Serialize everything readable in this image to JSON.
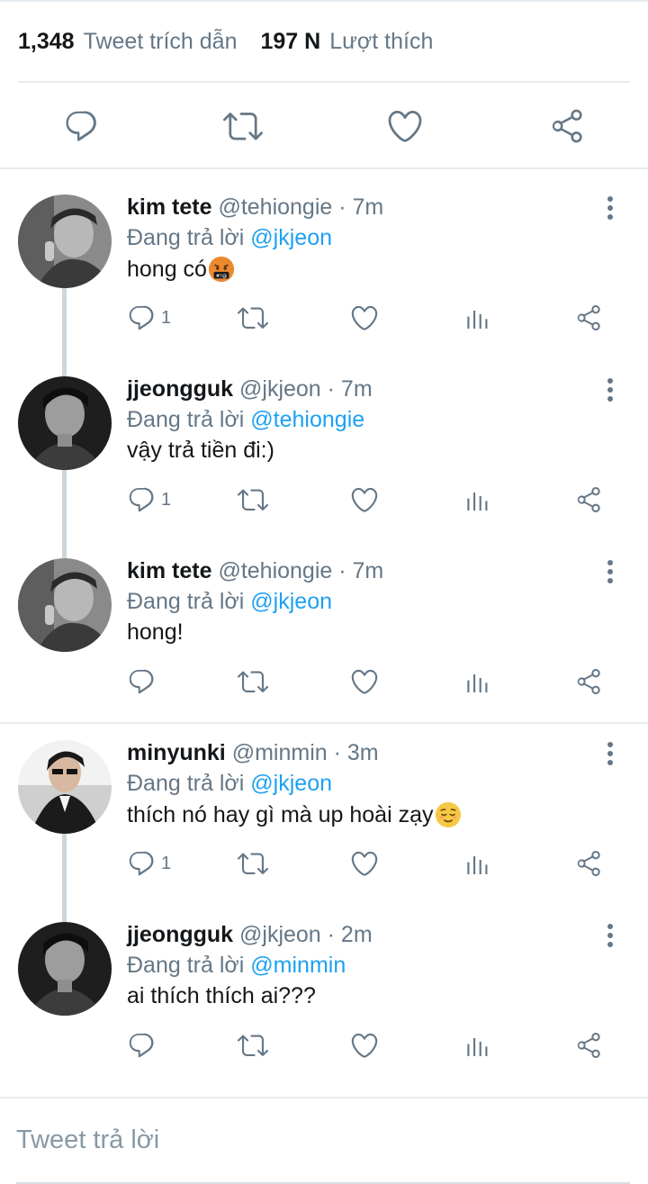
{
  "stats": {
    "quote_count": "1,348",
    "quote_label": "Tweet trích dẫn",
    "like_count": "197 N",
    "like_label": "Lượt thích"
  },
  "colors": {
    "icon_gray": "#657786",
    "link_blue": "#1da1f2",
    "divider": "#e6ecf0",
    "thread_line": "#ccd6dd"
  },
  "main_actions": [
    "reply-icon",
    "retweet-icon",
    "like-icon",
    "share-icon"
  ],
  "replies": [
    {
      "name": "kim tete",
      "meta": "@tehiongie · 7m",
      "replying_label": "Đang trả lời",
      "mention": "@jkjeon",
      "text": "hong có",
      "emoji": "cursing-face",
      "reply_count": "1"
    },
    {
      "name": "jjeongguk",
      "meta": "@jkjeon · 7m",
      "replying_label": "Đang trả lời",
      "mention": "@tehiongie",
      "text": "vậy trả tiền đi:)",
      "reply_count": "1"
    },
    {
      "name": "kim tete",
      "meta": "@tehiongie · 7m",
      "replying_label": "Đang trả lời",
      "mention": "@jkjeon",
      "text": "hong!",
      "reply_count": ""
    },
    {
      "name": "minyunki",
      "meta": "@minmin · 3m",
      "replying_label": "Đang trả lời",
      "mention": "@jkjeon",
      "text": "thích nó hay gì mà up hoài zạy",
      "emoji": "relieved-face",
      "reply_count": "1"
    },
    {
      "name": "jjeongguk",
      "meta": "@jkjeon · 2m",
      "replying_label": "Đang trả lời",
      "mention": "@minmin",
      "text": "ai thích thích ai???",
      "reply_count": ""
    }
  ],
  "compose": {
    "placeholder": "Tweet trả lời"
  }
}
